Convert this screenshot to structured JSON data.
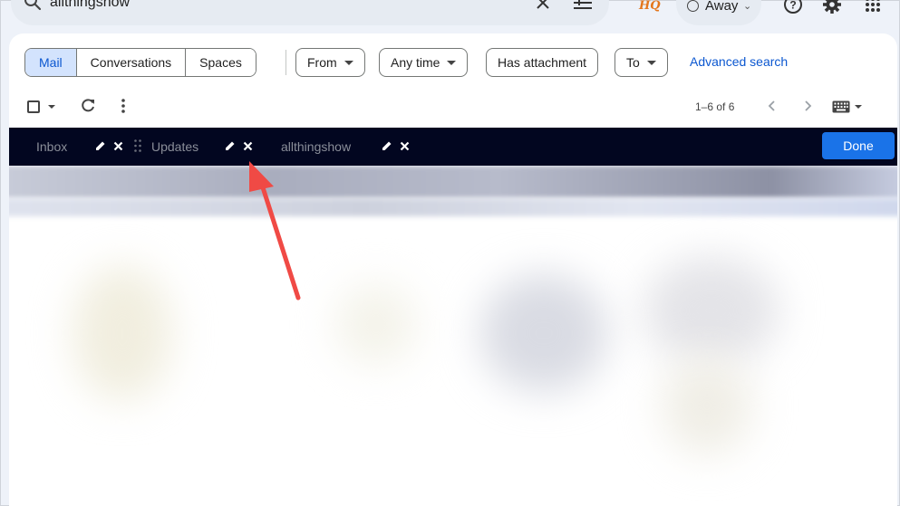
{
  "search": {
    "query": "allthingshow"
  },
  "topbar": {
    "logo_text": "HQ",
    "status": "Away"
  },
  "filters": {
    "segments": [
      {
        "label": "Mail",
        "active": true
      },
      {
        "label": "Conversations",
        "active": false
      },
      {
        "label": "Spaces",
        "active": false
      }
    ],
    "from": "From",
    "any_time": "Any time",
    "has_attachment": "Has attachment",
    "to": "To",
    "advanced_search": "Advanced search"
  },
  "toolbar": {
    "page_count": "1–6 of 6"
  },
  "tabs": {
    "items": [
      {
        "label": "Inbox"
      },
      {
        "label": "Updates"
      },
      {
        "label": "allthingshow"
      }
    ],
    "done_label": "Done"
  },
  "colors": {
    "accent": "#1a73e8",
    "tab_bar": "#020620",
    "arrow": "#f04a45",
    "active_segment": "#d3e3fd"
  },
  "icons": [
    "search-icon",
    "clear-icon",
    "tune-icon",
    "help-icon",
    "gear-icon",
    "apps-icon",
    "refresh-icon",
    "more-icon",
    "chevron-left-icon",
    "chevron-right-icon",
    "keyboard-icon",
    "pencil-icon",
    "close-icon",
    "drag-handle-icon"
  ]
}
